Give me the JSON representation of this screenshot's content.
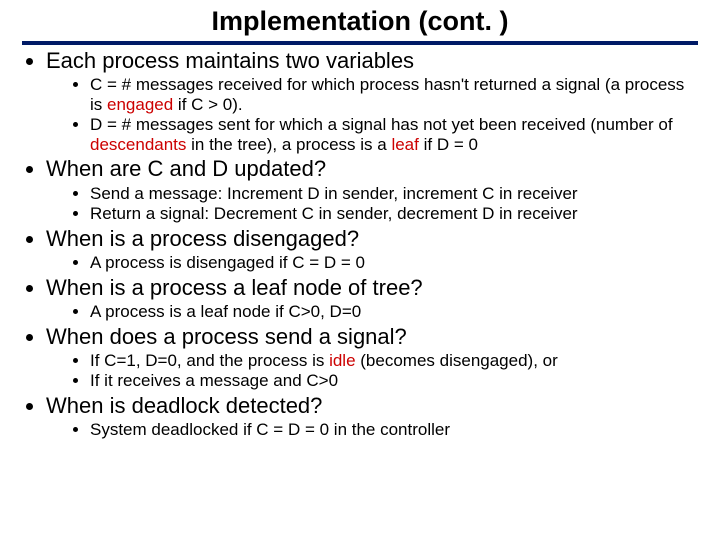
{
  "title": "Implementation (cont. )",
  "b1": {
    "head": "Each process maintains two variables",
    "sub1_pre": "C = # messages received for which process hasn't returned a signal (a process is ",
    "sub1_red": "engaged",
    "sub1_post": " if  C > 0).",
    "sub2_pre": "D = # messages sent for which a signal has not yet been received (number of ",
    "sub2_red1": "descendants",
    "sub2_mid": " in the tree), a process is a ",
    "sub2_red2": "leaf",
    "sub2_post": " if D = 0"
  },
  "b2": {
    "head": "When are C and D updated?",
    "sub1": "Send a message: Increment D in sender, increment C in receiver",
    "sub2": "Return a signal: Decrement C in sender, decrement D in receiver"
  },
  "b3": {
    "head": "When is a process disengaged?",
    "sub1": "A process is disengaged if C = D = 0"
  },
  "b4": {
    "head": "When is a process a leaf node of tree?",
    "sub1": "A process is a leaf node if C>0, D=0"
  },
  "b5": {
    "head": "When does a process send a signal?",
    "sub1_pre": "If C=1, D=0, and the process is ",
    "sub1_red": "idle",
    "sub1_post": " (becomes disengaged), or",
    "sub2": "If it receives a message and C>0"
  },
  "b6": {
    "head": "When is deadlock detected?",
    "sub1": "System deadlocked if C = D = 0 in the controller"
  }
}
